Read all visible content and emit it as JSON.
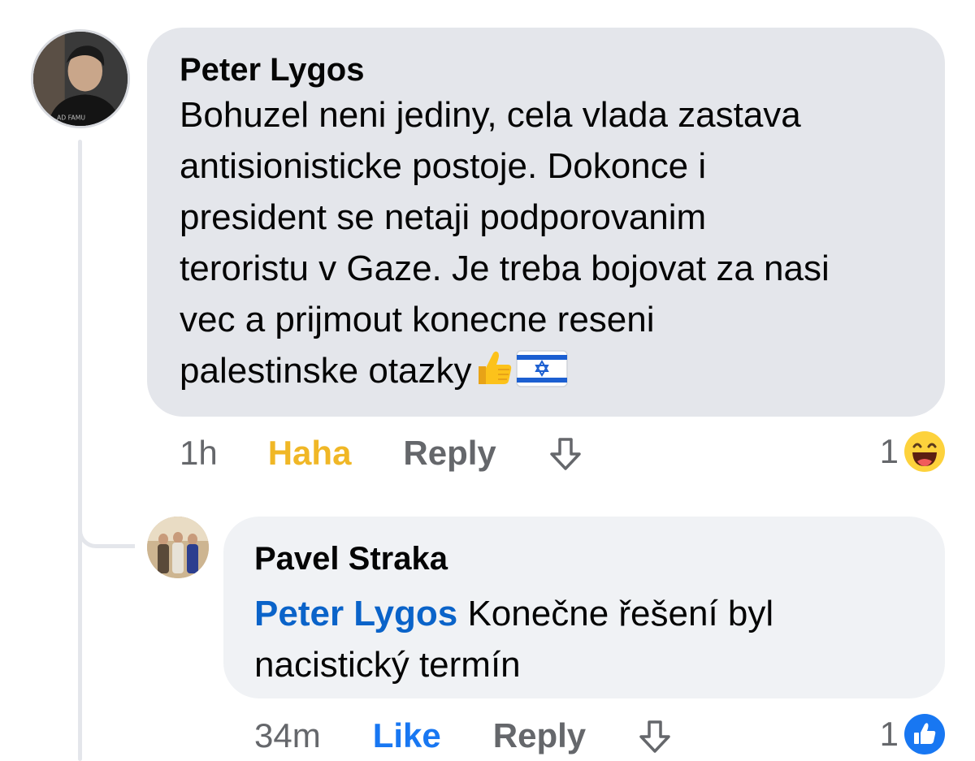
{
  "comments": [
    {
      "author": "Peter Lygos",
      "text_lines": [
        "Bohuzel neni jediny, cela vlada zastava",
        "antisionisticke postoje. Dokonce i",
        "president se netaji podporovanim",
        "teroristu v Gaze. Je treba bojovat za nasi",
        "vec a prijmout konecne reseni",
        "palestinske otazky"
      ],
      "emojis": [
        "thumbs-up-icon",
        "israel-flag-icon"
      ],
      "time": "1h",
      "reaction_label": "Haha",
      "reply_label": "Reply",
      "reaction_count": "1",
      "reaction_icon": "haha-emoji-icon"
    },
    {
      "author": "Pavel Straka",
      "mention": "Peter Lygos",
      "text_line_1": " Konečne řešení byl",
      "text_line_2": "nacistický termín",
      "time": "34m",
      "reaction_label": "Like",
      "reply_label": "Reply",
      "reaction_count": "1",
      "reaction_icon": "like-badge-icon"
    }
  ],
  "colors": {
    "bubble_primary": "#e4e6eb",
    "bubble_reply": "#f0f2f5",
    "mention": "#0a63c9",
    "haha": "#f0b726",
    "like": "#1877f2",
    "muted": "#65676b"
  }
}
